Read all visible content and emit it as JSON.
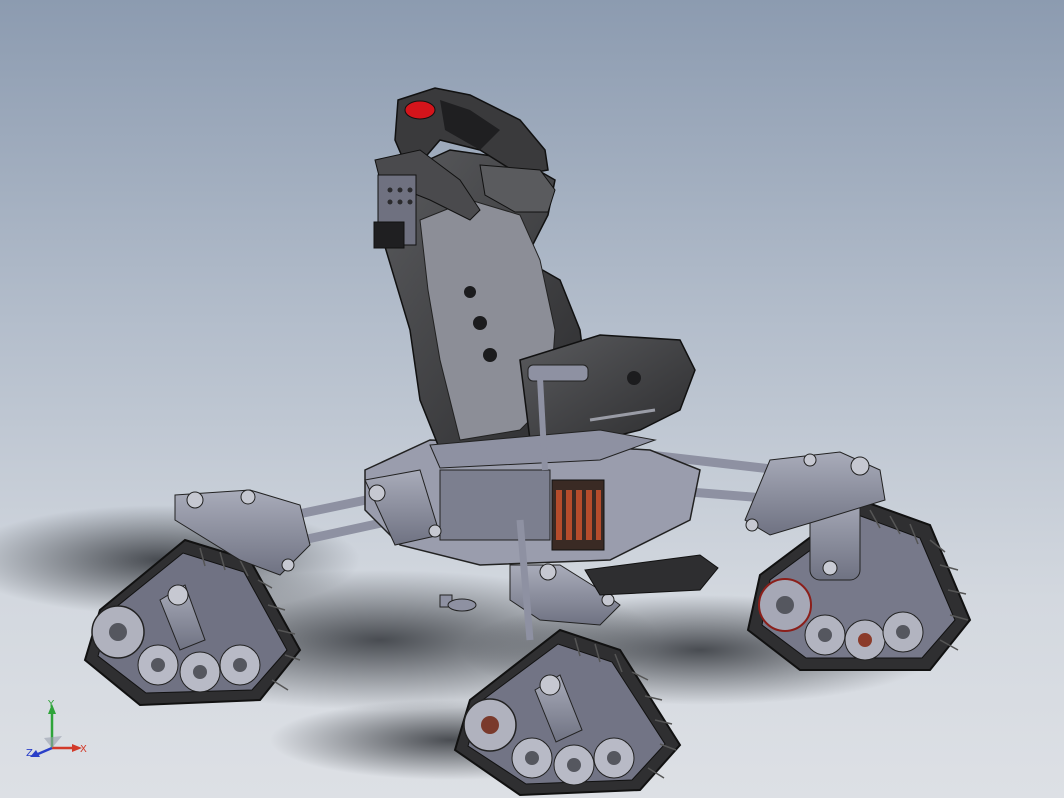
{
  "viewport": {
    "background_top": "#8c9bb0",
    "background_bottom": "#dde0e5",
    "model": "tracked-wheelchair-assembly"
  },
  "triad": {
    "x_label": "X",
    "y_label": "Y",
    "z_label": "Z",
    "x_color": "#d23a2a",
    "y_color": "#2fa43a",
    "z_color": "#2a3fc8"
  },
  "materials": {
    "seat_shell": "#3b3b3d",
    "frame": "#8e91a2",
    "track": "#2f2f31",
    "headrest_accent": "#d4141b"
  }
}
